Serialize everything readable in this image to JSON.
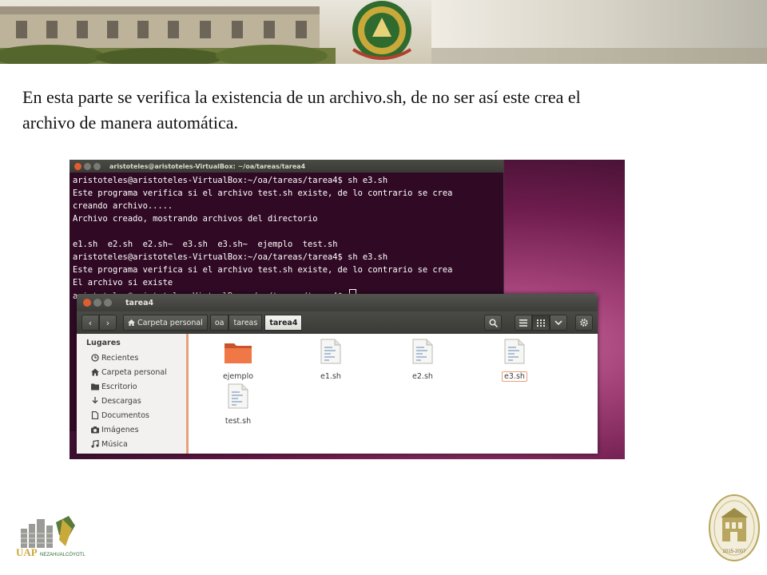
{
  "slide": {
    "text_line1": "En esta parte se verifica la existencia de un archivo.sh, de no ser así este crea el",
    "text_line2": "archivo de manera automática."
  },
  "terminal": {
    "title": "aristoteles@aristoteles-VirtualBox: ~/oa/tareas/tarea4",
    "lines": [
      "aristoteles@aristoteles-VirtualBox:~/oa/tareas/tarea4$ sh e3.sh",
      "Este programa verifica si el archivo test.sh existe, de lo contrario se crea",
      "creando archivo.....",
      "Archivo creado, mostrando archivos del directorio",
      "",
      "e1.sh  e2.sh  e2.sh~  e3.sh  e3.sh~  ejemplo  test.sh",
      "aristoteles@aristoteles-VirtualBox:~/oa/tareas/tarea4$ sh e3.sh",
      "Este programa verifica si el archivo test.sh existe, de lo contrario se crea",
      "El archivo si existe",
      "aristoteles@aristoteles-VirtualBox:~/oa/tareas/tarea4$ "
    ]
  },
  "file_manager": {
    "title": "tarea4",
    "back_icon": "‹",
    "forward_icon": "›",
    "breadcrumbs": [
      "Carpeta personal",
      "oa",
      "tareas",
      "tarea4"
    ],
    "search_icon": "search-icon",
    "sidebar": {
      "heading": "Lugares",
      "items": [
        {
          "label": "Recientes",
          "icon": "clock-icon"
        },
        {
          "label": "Carpeta personal",
          "icon": "home-icon"
        },
        {
          "label": "Escritorio",
          "icon": "folder-icon"
        },
        {
          "label": "Descargas",
          "icon": "download-icon"
        },
        {
          "label": "Documentos",
          "icon": "document-icon"
        },
        {
          "label": "Imágenes",
          "icon": "camera-icon"
        },
        {
          "label": "Música",
          "icon": "music-icon"
        }
      ]
    },
    "files": [
      {
        "name": "ejemplo",
        "type": "folder"
      },
      {
        "name": "e1.sh",
        "type": "script"
      },
      {
        "name": "e2.sh",
        "type": "script"
      },
      {
        "name": "e3.sh",
        "type": "script",
        "selected": true
      },
      {
        "name": "test.sh",
        "type": "script"
      }
    ]
  },
  "logos": {
    "uap_text": "UAP",
    "uap_subtext": "NEZAHUALCÓYOTL",
    "seal_text": "2015-2007"
  },
  "colors": {
    "terminal_bg": "#300a24",
    "ubuntu_orange": "#e8a07a",
    "header_gold": "#c7b27a",
    "folder_orange": "#f07746"
  }
}
